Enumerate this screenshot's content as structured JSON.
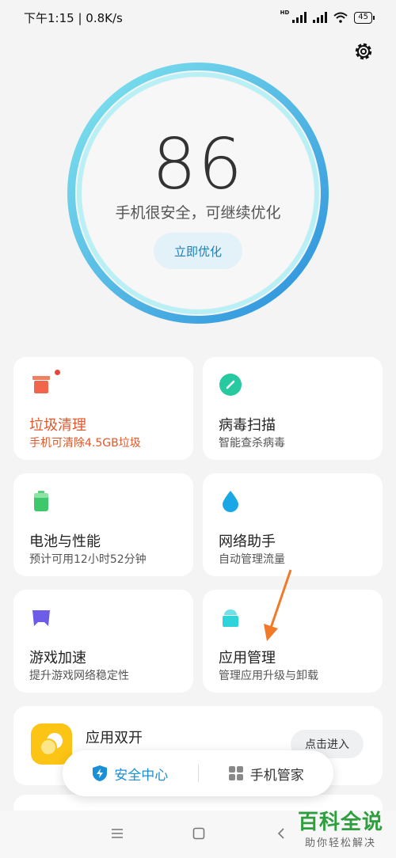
{
  "status_bar": {
    "time_speed": "下午1:15 | 0.8K/s",
    "hd": "HD",
    "battery": "45"
  },
  "score": {
    "value": "86",
    "message": "手机很安全，可继续优化",
    "button": "立即优化"
  },
  "cards": [
    {
      "title": "垃圾清理",
      "subtitle": "手机可清除4.5GB垃圾",
      "icon": "trash-bin-icon"
    },
    {
      "title": "病毒扫描",
      "subtitle": "智能查杀病毒",
      "icon": "virus-scan-icon"
    },
    {
      "title": "电池与性能",
      "subtitle": "预计可用12小时52分钟",
      "icon": "battery-icon"
    },
    {
      "title": "网络助手",
      "subtitle": "自动管理流量",
      "icon": "water-drop-icon"
    },
    {
      "title": "游戏加速",
      "subtitle": "提升游戏网络稳定性",
      "icon": "gamepad-icon"
    },
    {
      "title": "应用管理",
      "subtitle": "管理应用升级与卸载",
      "icon": "android-icon"
    }
  ],
  "dual_app": {
    "title": "应用双开",
    "button": "点击进入"
  },
  "tabs": [
    {
      "label": "安全中心",
      "active": true
    },
    {
      "label": "手机管家",
      "active": false
    }
  ],
  "watermark": {
    "title": "百科全说",
    "subtitle": "助你轻松解决"
  },
  "colors": {
    "accent": "#1b8fd6",
    "ring_outer": "#2a9fe0",
    "ring_inner": "#7fe3ef",
    "warning": "#e0582c",
    "watermark_green": "#2e9e3e"
  }
}
